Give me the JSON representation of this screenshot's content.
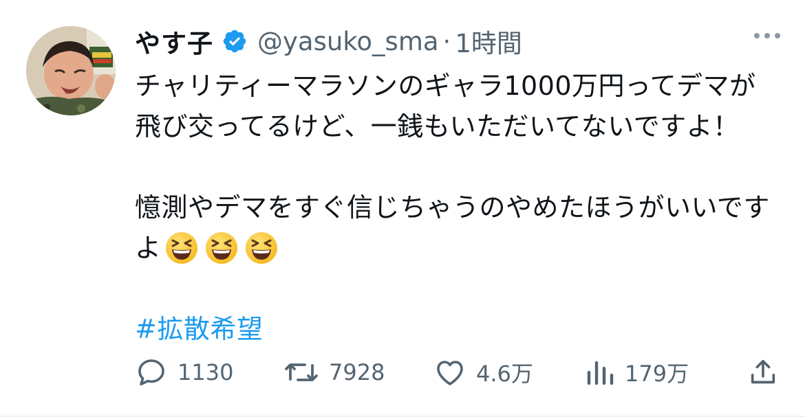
{
  "tweet": {
    "author_name": "やす子",
    "handle": "@yasuko_sma",
    "separator": "·",
    "time": "1時間",
    "text_main": "チャリティーマラソンのギャラ1000万円ってデマが飛び交ってるけど、一銭もいただいてないですよ！\n\n憶測やデマをすぐ信じちゃうのやめたほうがいいですよ",
    "emojis": [
      "grinning-squinting-face",
      "grinning-squinting-face",
      "grinning-squinting-face"
    ],
    "hashtag": "#拡散希望"
  },
  "actions": {
    "reply_count": "1130",
    "retweet_count": "7928",
    "like_count": "4.6万",
    "views_count": "179万"
  },
  "colors": {
    "link": "#1d9bf0",
    "secondary_text": "#536471",
    "verified": "#1d9bf0"
  }
}
